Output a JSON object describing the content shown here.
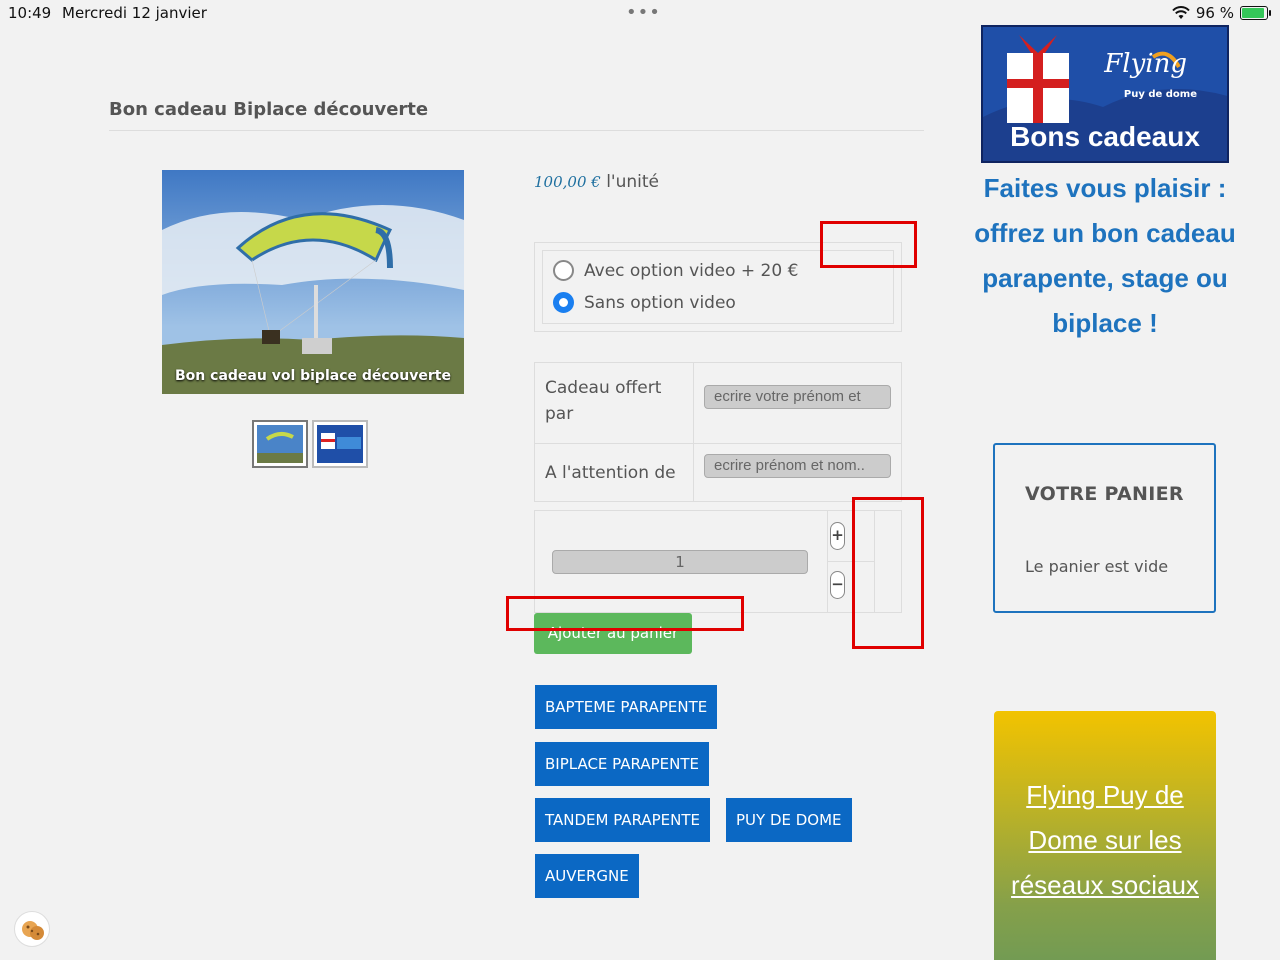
{
  "status_bar": {
    "time": "10:49",
    "date": "Mercredi 12 janvier",
    "dots": "•••",
    "battery": "96 %"
  },
  "product": {
    "title": "Bon cadeau Biplace découverte",
    "image_caption": "Bon cadeau vol biplace découverte",
    "price_amount": "100,00 €",
    "price_unit": "l'unité"
  },
  "options": [
    {
      "label": "Avec option video + 20 €",
      "checked": false
    },
    {
      "label": "Sans option video",
      "checked": true
    }
  ],
  "form": {
    "gift_from_label": "Cadeau offert par",
    "gift_from_placeholder": "ecrire votre prénom et",
    "attention_label": "A l'attention de",
    "attention_placeholder": "ecrire prénom et nom.."
  },
  "quantity": {
    "value": "1",
    "plus": "+",
    "minus": "−"
  },
  "add_to_cart": "Ajouter au panier",
  "tags": [
    "BAPTEME PARAPENTE",
    "BIPLACE PARAPENTE",
    "TANDEM PARAPENTE",
    "PUY DE DOME",
    "AUVERGNE"
  ],
  "sidebar": {
    "banner_brand": "Flying",
    "banner_sub": "Puy de dome",
    "banner_title": "Bons cadeaux",
    "promo": "Faites vous plaisir : offrez un bon cadeau parapente, stage ou biplace !",
    "cart_title": "VOTRE PANIER",
    "cart_empty": "Le panier est vide",
    "social": "Flying Puy de Dome sur les réseaux sociaux"
  },
  "colors": {
    "accent": "#1e73be",
    "tag": "#0b68c4",
    "cart_button": "#5cb85c",
    "annotation": "#e00000"
  }
}
